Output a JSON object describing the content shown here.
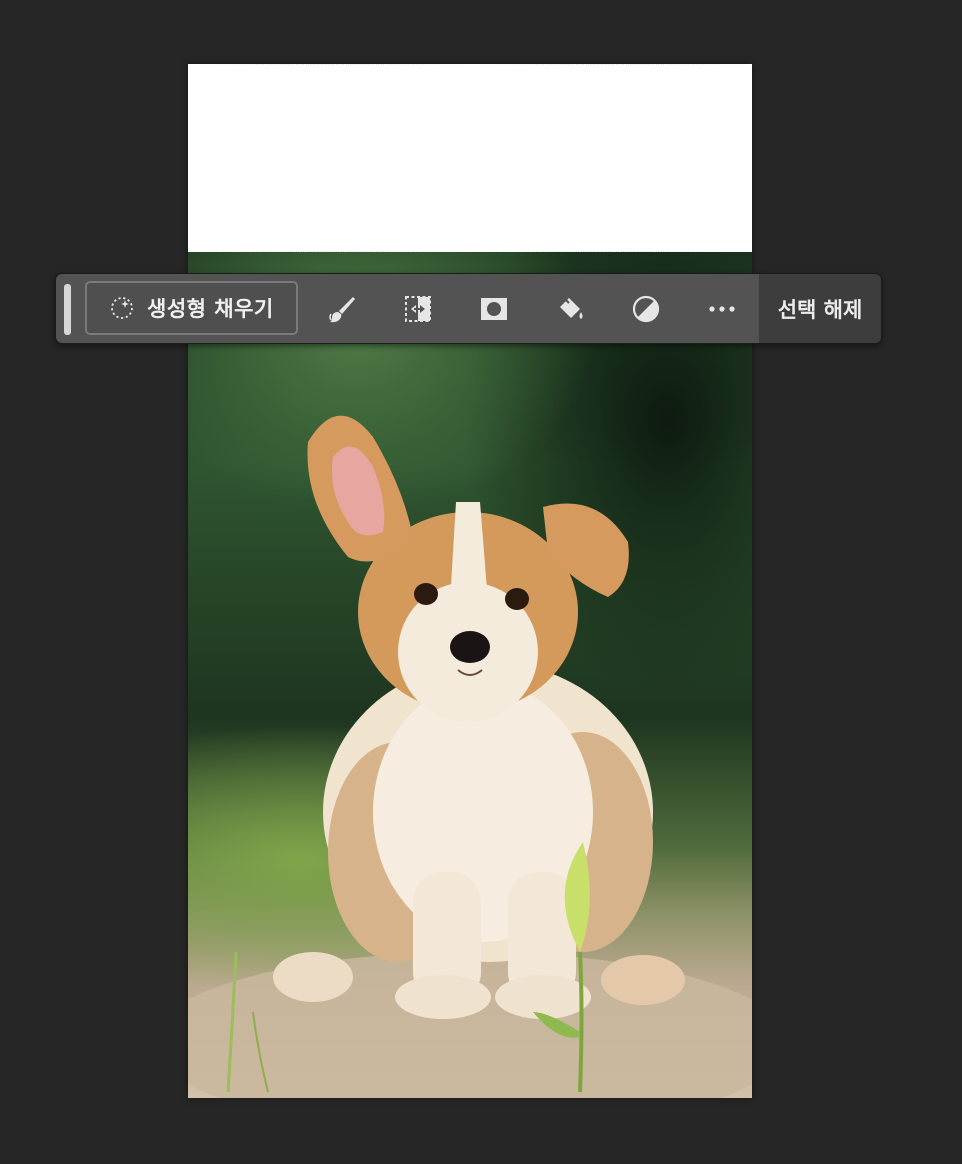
{
  "taskbar": {
    "generative_fill_label": "생성형 채우기",
    "deselect_label": "선택 해제",
    "tools": [
      {
        "name": "brush-mask-icon"
      },
      {
        "name": "transform-selection-icon"
      },
      {
        "name": "layer-mask-icon"
      },
      {
        "name": "fill-bucket-icon"
      },
      {
        "name": "adjustment-layer-icon"
      },
      {
        "name": "more-options-icon"
      }
    ]
  },
  "canvas": {
    "selection_fill_color": "#ffffff",
    "photo_subject": "corgi-puppy"
  },
  "colors": {
    "workspace_bg": "#262626",
    "taskbar_bg": "#535353",
    "deselect_bg": "#3d3d3d",
    "text": "#f0f0f0"
  }
}
